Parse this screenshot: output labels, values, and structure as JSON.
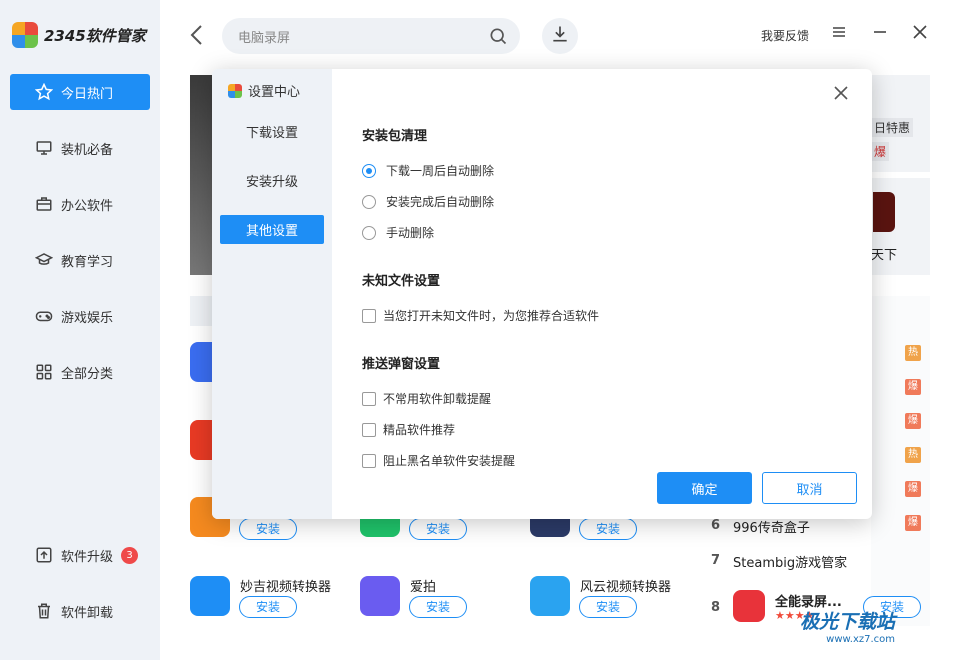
{
  "app": {
    "logo_text": "2345软件管家"
  },
  "sidebar": {
    "items": [
      {
        "label": "今日热门",
        "icon": "star-icon"
      },
      {
        "label": "装机必备",
        "icon": "monitor-icon"
      },
      {
        "label": "办公软件",
        "icon": "briefcase-icon"
      },
      {
        "label": "教育学习",
        "icon": "graduation-cap-icon"
      },
      {
        "label": "游戏娱乐",
        "icon": "gamepad-icon"
      },
      {
        "label": "全部分类",
        "icon": "grid-icon"
      }
    ],
    "upgrade_label": "软件升级",
    "upgrade_badge": "3",
    "uninstall_label": "软件卸载"
  },
  "header": {
    "search_placeholder": "电脑录屏",
    "feedback": "我要反馈"
  },
  "background": {
    "right_tags": [
      "日特惠",
      "爆"
    ],
    "right_game_text": "天下",
    "apps_row3": [
      "安装",
      "安装",
      "安装"
    ],
    "apps_row4": [
      {
        "name": "妙吉视频转换器",
        "install": "安装"
      },
      {
        "name": "爱拍",
        "install": "安装"
      },
      {
        "name": "风云视频转换器",
        "install": "安装"
      }
    ],
    "ranks": [
      {
        "num": "6",
        "name": "996传奇盒子"
      },
      {
        "num": "7",
        "name": "Steambig游戏管家"
      },
      {
        "num": "8",
        "name": "全能录屏..."
      }
    ],
    "rank8_install": "安装",
    "hot_badges": [
      "热",
      "爆",
      "爆",
      "热",
      "爆",
      "爆"
    ]
  },
  "modal": {
    "title": "设置中心",
    "tabs": [
      "下载设置",
      "安装升级",
      "其他设置"
    ],
    "active_tab": "其他设置",
    "sections": {
      "cleanup": {
        "title": "安装包清理",
        "options": [
          "下载一周后自动删除",
          "安装完成后自动删除",
          "手动删除"
        ],
        "selected": "下载一周后自动删除"
      },
      "unknown_files": {
        "title": "未知文件设置",
        "options": [
          "当您打开未知文件时，为您推荐合适软件"
        ]
      },
      "popups": {
        "title": "推送弹窗设置",
        "options": [
          "不常用软件卸载提醒",
          "精品软件推荐",
          "阻止黑名单软件安装提醒"
        ]
      }
    },
    "ok_label": "确定",
    "cancel_label": "取消"
  },
  "watermark": {
    "text": "极光下载站",
    "url": "www.xz7.com"
  },
  "colors": {
    "accent": "#1e8ef5",
    "sidebar_bg": "#eef2f7"
  }
}
